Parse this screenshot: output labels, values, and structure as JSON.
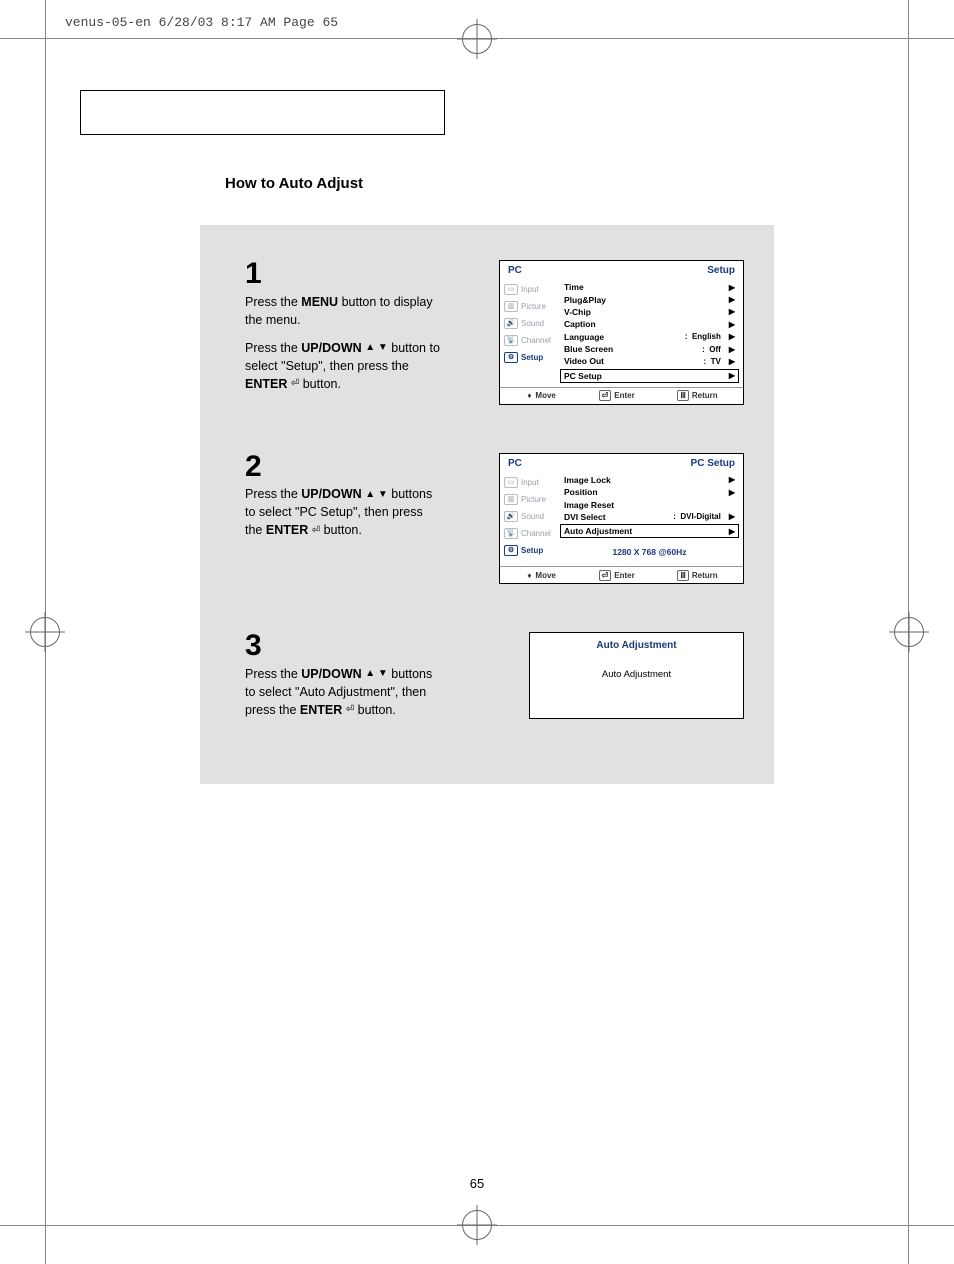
{
  "slug": "venus-05-en  6/28/03  8:17 AM  Page 65",
  "section_title": "How to Auto Adjust",
  "page_number": "65",
  "steps": {
    "s1": {
      "num": "1",
      "p1a": "Press the ",
      "p1b": "MENU",
      "p1c": " button to display the menu.",
      "p2a": "Press the ",
      "p2b": "UP/DOWN",
      "p2c": " button to select \"Setup\", then press the ",
      "p2d": "ENTER",
      "p2e": " button."
    },
    "s2": {
      "num": "2",
      "p1a": "Press the ",
      "p1b": "UP/DOWN",
      "p1c": " buttons to select \"PC Setup\", then press the ",
      "p1d": "ENTER",
      "p1e": " button."
    },
    "s3": {
      "num": "3",
      "p1a": "Press the ",
      "p1b": "UP/DOWN",
      "p1c": " buttons to select \"Auto Adjustment\", then press the ",
      "p1d": "ENTER",
      "p1e": "  button."
    }
  },
  "osd": {
    "pc": "PC",
    "setup": "Setup",
    "pcsetup": "PC Setup",
    "nav": {
      "input": "Input",
      "picture": "Picture",
      "sound": "Sound",
      "channel": "Channel",
      "setup_item": "Setup"
    },
    "menu1": {
      "time": "Time",
      "plugplay": "Plug&Play",
      "vchip": "V-Chip",
      "caption": "Caption",
      "language": "Language",
      "language_val": "English",
      "bluescreen": "Blue Screen",
      "bluescreen_val": "Off",
      "videoout": "Video Out",
      "videoout_val": "TV",
      "pcsetup_item": "PC Setup"
    },
    "menu2": {
      "imagelock": "Image Lock",
      "position": "Position",
      "imagereset": "Image Reset",
      "dviselect": "DVI Select",
      "dviselect_val": "DVI-Digital",
      "autoadj": "Auto Adjustment",
      "resolution": "1280 X 768 @60Hz"
    },
    "footer": {
      "move": "Move",
      "enter": "Enter",
      "return": "Return"
    }
  },
  "autoadj": {
    "title": "Auto Adjustment",
    "body": "Auto Adjustment"
  },
  "glyphs": {
    "updown": "▲ ▼",
    "right": "▶",
    "colon": ":"
  }
}
